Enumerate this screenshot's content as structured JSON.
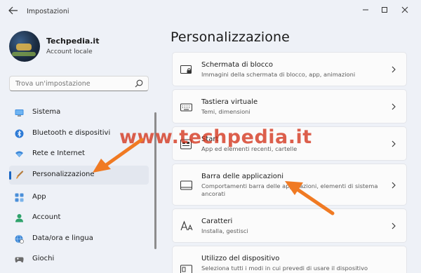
{
  "window": {
    "title": "Impostazioni"
  },
  "profile": {
    "name": "Techpedia.it",
    "account_type": "Account locale"
  },
  "search": {
    "placeholder": "Trova un'impostazione"
  },
  "nav": {
    "items": [
      {
        "label": "Sistema",
        "icon": "monitor-icon",
        "selected": false
      },
      {
        "label": "Bluetooth e dispositivi",
        "icon": "bluetooth-icon",
        "selected": false
      },
      {
        "label": "Rete e Internet",
        "icon": "wifi-icon",
        "selected": false
      },
      {
        "label": "Personalizzazione",
        "icon": "brush-icon",
        "selected": true
      },
      {
        "label": "App",
        "icon": "apps-icon",
        "selected": false
      },
      {
        "label": "Account",
        "icon": "person-icon",
        "selected": false
      },
      {
        "label": "Data/ora e lingua",
        "icon": "globe-clock-icon",
        "selected": false
      },
      {
        "label": "Giochi",
        "icon": "gamepad-icon",
        "selected": false
      }
    ]
  },
  "main": {
    "title": "Personalizzazione",
    "cards": [
      {
        "title": "Schermata di blocco",
        "subtitle": "Immagini della schermata di blocco, app, animazioni",
        "icon": "lock-screen-icon"
      },
      {
        "title": "Tastiera virtuale",
        "subtitle": "Temi, dimensioni",
        "icon": "keyboard-icon"
      },
      {
        "title": "Start",
        "subtitle": "App ed elementi recenti, cartelle",
        "icon": "start-icon"
      },
      {
        "title": "Barra delle applicazioni",
        "subtitle": "Comportamenti barra delle applicazioni, elementi di sistema ancorati",
        "icon": "taskbar-icon"
      },
      {
        "title": "Caratteri",
        "subtitle": "Installa, gestisci",
        "icon": "fonts-icon"
      },
      {
        "title": "Utilizzo del dispositivo",
        "subtitle": "Seleziona tutti i modi in cui prevedi di usare il dispositivo",
        "icon": "device-usage-icon"
      }
    ]
  },
  "watermark": "www.techpedia.it",
  "colors": {
    "accent": "#1a66c4",
    "arrow": "#f07a23",
    "watermark": "#d4341c"
  }
}
